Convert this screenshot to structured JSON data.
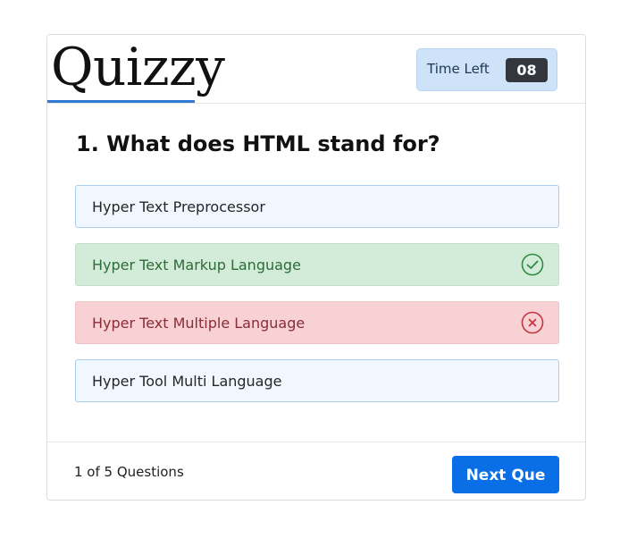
{
  "app": {
    "title": "Quizzy"
  },
  "timer": {
    "label": "Time Left",
    "value": "08"
  },
  "question": {
    "text": "1. What does HTML stand for?"
  },
  "options": [
    {
      "label": "Hyper Text Preprocessor",
      "state": "neutral"
    },
    {
      "label": "Hyper Text Markup Language",
      "state": "correct",
      "icon": "check-circle-icon"
    },
    {
      "label": "Hyper Text Multiple Language",
      "state": "incorrect",
      "icon": "x-circle-icon"
    },
    {
      "label": "Hyper Tool Multi Language",
      "state": "neutral"
    }
  ],
  "footer": {
    "progress": "1 of 5 Questions",
    "next_label": "Next Que"
  },
  "colors": {
    "accent": "#0a6fe6",
    "correct": "#2f8a44",
    "incorrect": "#c1363f",
    "timer_bg": "#cfe3f8"
  }
}
